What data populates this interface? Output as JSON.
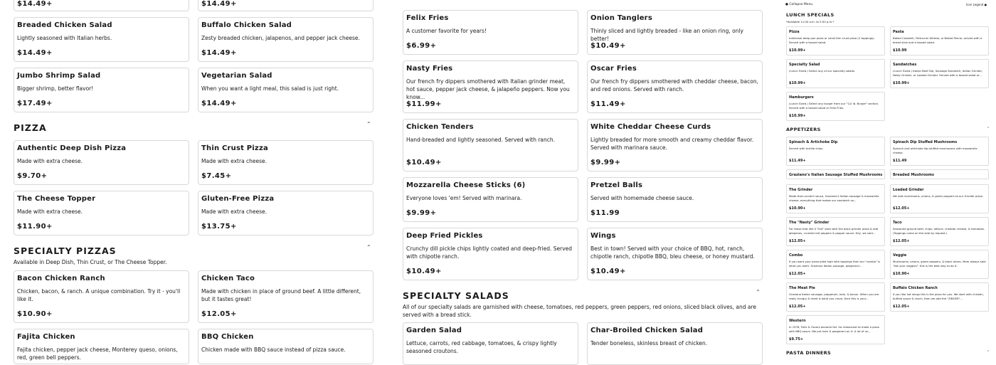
{
  "left": {
    "top_partial_prices": [
      "$14.49+",
      "$14.49+"
    ],
    "salads": [
      {
        "name": "Breaded Chicken Salad",
        "desc": "Lightly seasoned with Italian herbs.",
        "price": "$14.49+"
      },
      {
        "name": "Buffalo Chicken Salad",
        "desc": "Zesty breaded chicken, jalapenos, and pepper jack cheese.",
        "price": "$14.49+"
      },
      {
        "name": "Jumbo Shrimp Salad",
        "desc": "Bigger shrimp, better flavor!",
        "price": "$17.49+"
      },
      {
        "name": "Vegetarian Salad",
        "desc": "When you want a light meal, this salad is just right.",
        "price": "$14.49+"
      }
    ],
    "pizza_title": "PIZZA",
    "pizza": [
      {
        "name": "Authentic Deep Dish Pizza",
        "desc": "Made with extra cheese.",
        "price": "$9.70+"
      },
      {
        "name": "Thin Crust Pizza",
        "desc": "Made with extra cheese.",
        "price": "$7.45+"
      },
      {
        "name": "The Cheese Topper",
        "desc": "Made with extra cheese.",
        "price": "$11.90+"
      },
      {
        "name": "Gluten-Free Pizza",
        "desc": "Made with extra cheese.",
        "price": "$13.75+"
      }
    ],
    "specialty_title": "SPECIALTY PIZZAS",
    "specialty_sub": "Available in Deep Dish, Thin Crust, or The Cheese Topper.",
    "specialty": [
      {
        "name": "Bacon Chicken Ranch",
        "desc": "Chicken, bacon, & ranch. A unique combination. Try it - you'll like it.",
        "price": "$10.90+"
      },
      {
        "name": "Chicken Taco",
        "desc": "Made with chicken in place of ground beef. A little different, but it tastes great!",
        "price": "$12.05+"
      },
      {
        "name": "Fajita Chicken",
        "desc": "Fajita chicken, pepper jack cheese, Monterey queso, onions, red, green bell peppers.",
        "price": ""
      },
      {
        "name": "BBQ Chicken",
        "desc": "Chicken made with BBQ sauce instead of pizza sauce.",
        "price": ""
      }
    ]
  },
  "middle": {
    "apps": [
      {
        "name": "Felix Fries",
        "desc": "A customer favorite for years!",
        "price": "$6.99+"
      },
      {
        "name": "Onion Tanglers",
        "desc": "Thinly sliced and lightly breaded - like an onion ring, only better!",
        "price": "$10.49+"
      },
      {
        "name": "Nasty Fries",
        "desc": "Our french fry dippers smothered with Italian grinder meat, hot sauce, pepper jack cheese, & jalapeño peppers. Now you know...",
        "price": "$11.99+"
      },
      {
        "name": "Oscar Fries",
        "desc": "Our french fry dippers smothered with cheddar cheese, bacon, and red onions. Served with ranch.",
        "price": "$11.49+"
      },
      {
        "name": "Chicken Tenders",
        "desc": "Hand-breaded and lightly seasoned. Served with ranch.",
        "price": "$10.49+"
      },
      {
        "name": "White Cheddar Cheese Curds",
        "desc": "Lightly breaded for more smooth and creamy cheddar flavor. Served with marinara sauce.",
        "price": "$9.99+"
      },
      {
        "name": "Mozzarella Cheese Sticks (6)",
        "desc": "Everyone loves 'em! Served with marinara.",
        "price": "$9.99+"
      },
      {
        "name": "Pretzel Balls",
        "desc": "Served with homemade cheese sauce.",
        "price": "$11.99"
      },
      {
        "name": "Deep Fried Pickles",
        "desc": "Crunchy dill pickle chips lightly coated and deep-fried. Served with chipotle ranch.",
        "price": "$10.49+"
      },
      {
        "name": "Wings",
        "desc": "Best in town! Served with your choice of BBQ, hot, ranch, chipotle ranch, chipotle BBQ, bleu cheese, or honey mustard.",
        "price": "$10.49+"
      }
    ],
    "salads_title": "SPECIALTY SALADS",
    "salads_sub": "All of our specialty salads are garnished with cheese, tomatoes, red peppers, green peppers, red onions, sliced black olives, and are served with a bread stick.",
    "salads": [
      {
        "name": "Garden Salad",
        "desc": "Lettuce, carrots, red cabbage, tomatoes, & crispy lightly seasoned croutons.",
        "price": ""
      },
      {
        "name": "Char-Broiled Chicken Salad",
        "desc": "Tender boneless, skinless breast of chicken.",
        "price": ""
      }
    ]
  },
  "right": {
    "collapse_label": "Collapse Menu",
    "legend_label": "Icon Legend",
    "lunch_title": "LUNCH SPECIALS",
    "lunch_sub": "*Available 11:00 a.m. to 2:00 p.m.*",
    "lunch": [
      {
        "name": "Pizza",
        "desc": "Individual deep pan pizza or small thin crust pizza (2 toppings). Served with a tossed salad.",
        "price": "$10.99+"
      },
      {
        "name": "Pasta",
        "desc": "Baked Cavatelli, Fettuccini Alfredo, or Baked Penne, served with a bread stick and a tossed salad.",
        "price": "$10.99"
      },
      {
        "name": "Specialty Salad",
        "desc": "(Lunch Sized.) Select any of our specialty salads.",
        "price": "$10.99+"
      },
      {
        "name": "Sandwiches",
        "desc": "(Lunch Sized.) Italian Beef Dip, Sausage Sandwich, Italian Grinder, Nasty Grinder, or Loaded Grinder. Served with a tossed salad or...",
        "price": "$10.99+"
      },
      {
        "name": "Hamburgers",
        "desc": "(Lunch Sized.) Select any burger from our \"1/2 lb. Burger\" section. Served with a tossed salad or Felix Fries.",
        "price": "$10.99+"
      }
    ],
    "apps_title": "APPETIZERS",
    "apps": [
      {
        "name": "Spinach & Artichoke Dip",
        "desc": "Served with tortilla chips.",
        "price": "$11.49+"
      },
      {
        "name": "Spinach Dip Stuffed Mushrooms",
        "desc": "Spinach and artichoke dip-stuffed mushrooms with mozzarella cheese.",
        "price": "$11.49"
      },
      {
        "name": "Graziano's Italian Sausage Stuffed Mushrooms",
        "desc": "",
        "price": ""
      },
      {
        "name": "Breaded Mushrooms",
        "desc": "",
        "price": ""
      }
    ],
    "grinders": [
      {
        "name": "The Grinder",
        "desc": "Made-from-scratch sauce, Graziano's Italian sausage & mozzarella cheese, everything that makes our sandwich so...",
        "price": "$10.90+"
      },
      {
        "name": "Loaded Grinder",
        "desc": "We add mushrooms, onions, & green peppers to our Grinder pizza.",
        "price": "$12.05+"
      },
      {
        "name": "The \"Nasty\" Grinder",
        "desc": "For those that like it \"hot\" start with the basic grinder pizza & add jalapenos, crushed red peppers & pepper sauce. Hey, we said...",
        "price": "$12.05+"
      },
      {
        "name": "Taco",
        "desc": "Seasoned ground beef, chips, lettuce, cheddar cheese, & tomatoes. (Toppings come on the side by request.)",
        "price": "$12.05+"
      },
      {
        "name": "Combo",
        "desc": "If you want your pizza piled high with toppings then our \"combo\" is what you want. Graziano Italian sausage, pepperoni...",
        "price": "$12.05+"
      },
      {
        "name": "Veggie",
        "desc": "Mushrooms, onions, green peppers, & black olives. Mom always said \"eat your veggies\"; this is the best way to do it.",
        "price": "$10.90+"
      },
      {
        "name": "The Meat Pie",
        "desc": "Graziano Italian sausage, pepperoni, ham, & bacon. When you are really hungry & meat is what you crave, then this is your...",
        "price": "$12.05+"
      },
      {
        "name": "Buffalo Chicken Ranch",
        "desc": "If you like hot wings this is the pizza for you. We start with chicken, buffalo sauce & ranch, then we add the \"ZINGER\"...",
        "price": "$12.05+"
      },
      {
        "name": "Western",
        "desc": "In 1978, Felix & Oscars became the 1st restaurant to make a pizza with BBQ sauce. We put ham & pepperoni on it. A lot of us...",
        "price": "$9.75+"
      }
    ],
    "pasta_title": "PASTA DINNERS"
  }
}
